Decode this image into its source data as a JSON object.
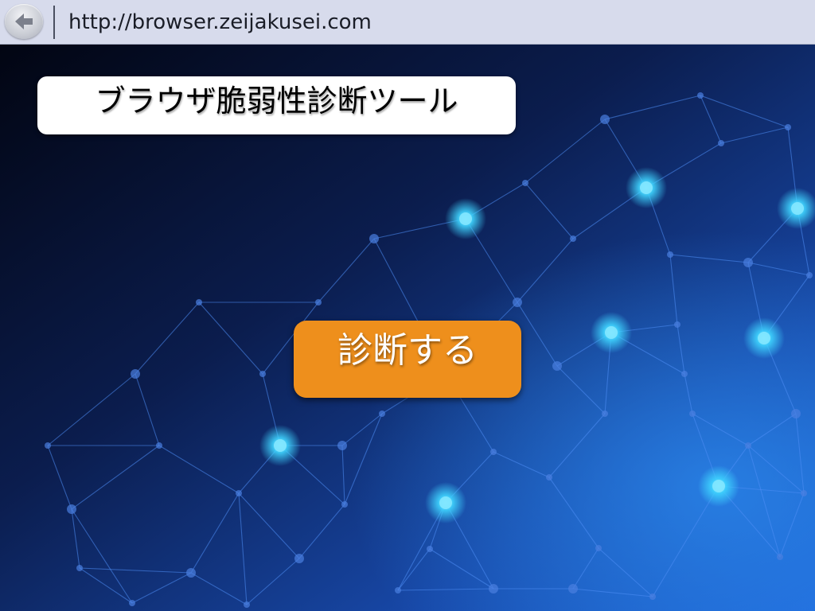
{
  "browser": {
    "url": "http://browser.zeijakusei.com",
    "back_icon": "arrow-left-icon"
  },
  "main": {
    "title": "ブラウザ脆弱性診断ツール",
    "diagnose_label": "診断する"
  },
  "colors": {
    "bar_background": "#d7dbec",
    "button_accent": "#ee8f1c",
    "background_dark": "#040a1c",
    "background_blue": "#1d5fd0",
    "node_glow": "#3fd4ff"
  }
}
